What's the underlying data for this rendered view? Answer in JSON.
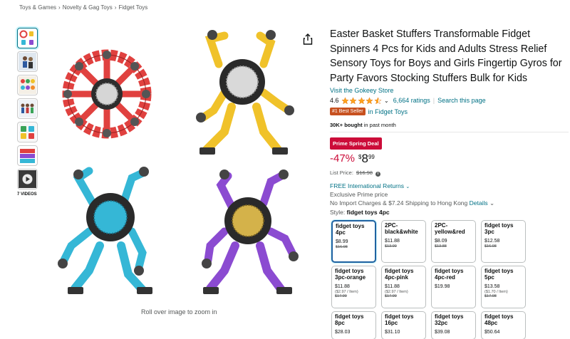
{
  "breadcrumb": {
    "items": [
      "Toys & Games",
      "Novelty & Gag Toys",
      "Fidget Toys"
    ],
    "separator": "›"
  },
  "gallery": {
    "thumbnails": [
      "thumbnail-1",
      "thumbnail-2",
      "thumbnail-3",
      "thumbnail-4",
      "thumbnail-5",
      "thumbnail-6",
      "video-thumbnail"
    ],
    "videos_label": "7 VIDEOS",
    "zoom_hint": "Roll over image to zoom in",
    "spinner_colors": [
      "#e0413f",
      "#f0c22a",
      "#35b7d6",
      "#8b4bd1"
    ]
  },
  "product": {
    "title": "Easter Basket Stuffers Transformable Fidget Spinners 4 Pcs for Kids and Adults Stress Relief Sensory Toys for Boys and Girls Fingertip Gyros for Party Favors Stocking Stuffers Bulk for Kids",
    "store_link": "Visit the Gokeey Store",
    "rating": "4.6",
    "stars_filled": 4.5,
    "ratings_count": "6,664 ratings",
    "search_page": "Search this page",
    "best_seller_badge": "#1 Best Seller",
    "best_seller_category": "in Fidget Toys",
    "bought_bold": "30K+ bought",
    "bought_rest": "in past month",
    "deal_badge": "Prime Spring Deal",
    "discount": "-47%",
    "price_symbol": "$",
    "price_whole": "8",
    "price_fraction": "99",
    "list_price_label": "List Price:",
    "list_price_value": "$16.98",
    "shipping": "FREE International Returns",
    "prime_price": "Exclusive Prime price",
    "import_text": "No Import Charges & $7.24 Shipping to Hong Kong",
    "details_link": "Details",
    "style_label": "Style:",
    "style_value": "fidget toys 4pc",
    "colors": {
      "link": "#007185",
      "deal_red": "#CC0C39",
      "best_seller": "#C7511F",
      "star": "#FFA41C"
    }
  },
  "options": [
    {
      "name": "fidget toys 4pc",
      "price": "$8.99",
      "unit": "",
      "list": "$16.98",
      "selected": true
    },
    {
      "name": "2PC-black&white",
      "price": "$11.88",
      "unit": "",
      "list": "$13.99",
      "selected": false
    },
    {
      "name": "2PC-yellow&red",
      "price": "$8.09",
      "unit": "",
      "list": "$13.88",
      "selected": false
    },
    {
      "name": "fidget toys 3pc",
      "price": "$12.58",
      "unit": "",
      "list": "$16.98",
      "selected": false
    },
    {
      "name": "fidget toys 3pc-orange",
      "price": "$11.88",
      "unit": "($2.97 / Item)",
      "list": "$17.99",
      "selected": false
    },
    {
      "name": "fidget toys 4pc-pink",
      "price": "$11.88",
      "unit": "($2.97 / Item)",
      "list": "$17.99",
      "selected": false
    },
    {
      "name": "fidget toys 4pc-red",
      "price": "$19.98",
      "unit": "",
      "list": "",
      "selected": false
    },
    {
      "name": "fidget toys 5pc",
      "price": "$13.58",
      "unit": "($1.70 / Item)",
      "list": "$17.98",
      "selected": false
    },
    {
      "name": "fidget toys 8pc",
      "price": "$28.03",
      "unit": "",
      "list": "",
      "selected": false
    },
    {
      "name": "fidget toys 16pc",
      "price": "$31.10",
      "unit": "",
      "list": "",
      "selected": false
    },
    {
      "name": "fidget toys 32pc",
      "price": "$39.08",
      "unit": "",
      "list": "",
      "selected": false
    },
    {
      "name": "fidget toys 48pc",
      "price": "$50.64",
      "unit": "",
      "list": "",
      "selected": false
    }
  ]
}
